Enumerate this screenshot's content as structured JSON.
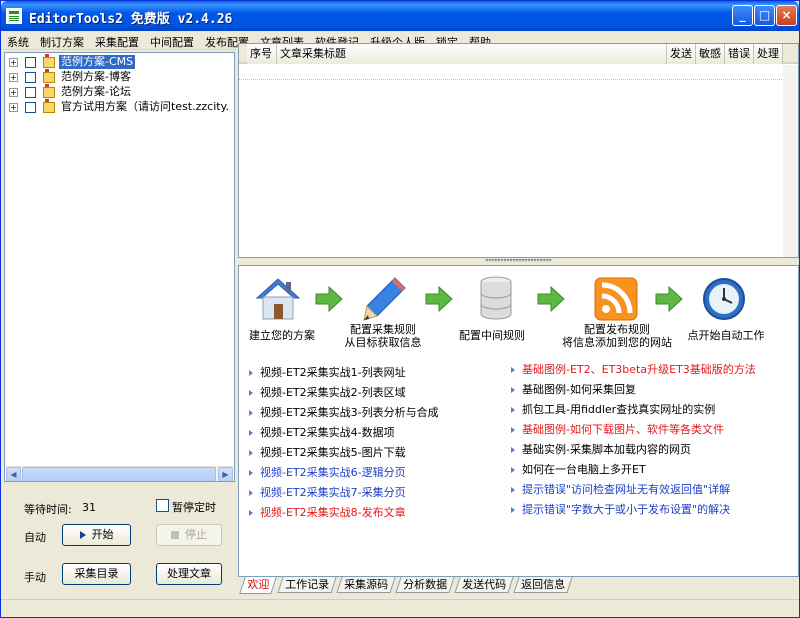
{
  "window": {
    "title": "EditorTools2 免费版 v2.4.26",
    "controls": {
      "minimize": "_",
      "maximize": "□",
      "close": "×"
    }
  },
  "menu": [
    "系统",
    "制订方案",
    "采集配置",
    "中间配置",
    "发布配置",
    "文章列表",
    "软件登记",
    "升级个人版",
    "锁定",
    "帮助"
  ],
  "tree": [
    {
      "label": "范例方案-CMS",
      "selected": true
    },
    {
      "label": "范例方案-博客",
      "selected": false
    },
    {
      "label": "范例方案-论坛",
      "selected": false
    },
    {
      "label": "官方试用方案（请访问test.zzcity.",
      "selected": false
    }
  ],
  "controls": {
    "wait_label": "等待时间:",
    "wait_value": "31",
    "pause_label": "暂停定时",
    "auto_label": "自动",
    "start_button": "开始",
    "stop_button": "停止",
    "manual_label": "手动",
    "collect_list_button": "采集目录",
    "process_article_button": "处理文章"
  },
  "list_columns": [
    "序号",
    "文章采集标题",
    "发送",
    "敏感",
    "错误",
    "处理"
  ],
  "steps": [
    {
      "label_line1": "建立您的方案",
      "label_line2": "",
      "icon": "house-icon"
    },
    {
      "label_line1": "配置采集规则",
      "label_line2": "从目标获取信息",
      "icon": "pencil-icon"
    },
    {
      "label_line1": "配置中间规则",
      "label_line2": "",
      "icon": "database-icon"
    },
    {
      "label_line1": "配置发布规则",
      "label_line2": "将信息添加到您的网站",
      "icon": "rss-icon"
    },
    {
      "label_line1": "点开始自动工作",
      "label_line2": "",
      "icon": "clock-icon"
    }
  ],
  "links_left": [
    {
      "text": "视频-ET2采集实战1-列表网址",
      "color": "#000000"
    },
    {
      "text": "视频-ET2采集实战2-列表区域",
      "color": "#000000"
    },
    {
      "text": "视频-ET2采集实战3-列表分析与合成",
      "color": "#000000"
    },
    {
      "text": "视频-ET2采集实战4-数据项",
      "color": "#000000"
    },
    {
      "text": "视频-ET2采集实战5-图片下载",
      "color": "#000000"
    },
    {
      "text": "视频-ET2采集实战6-逻辑分页",
      "color": "#1c3fc8"
    },
    {
      "text": "视频-ET2采集实战7-采集分页",
      "color": "#1c3fc8"
    },
    {
      "text": "视频-ET2采集实战8-发布文章",
      "color": "#e0191b"
    }
  ],
  "links_right": [
    {
      "text": "基础图例-ET2、ET3beta升级ET3基础版的方法",
      "color": "#e0191b"
    },
    {
      "text": "基础图例-如何采集回复",
      "color": "#000000"
    },
    {
      "text": "抓包工具-用fiddler查找真实网址的实例",
      "color": "#000000"
    },
    {
      "text": "基础图例-如何下载图片、软件等各类文件",
      "color": "#e0191b"
    },
    {
      "text": "基础实例-采集脚本加载内容的网页",
      "color": "#000000"
    },
    {
      "text": "如何在一台电脑上多开ET",
      "color": "#000000"
    },
    {
      "text": "提示错误\"访问检查网址无有效返回值\"详解",
      "color": "#1c3fc8"
    },
    {
      "text": "提示错误\"字数大于或小于发布设置\"的解决",
      "color": "#1c3fc8"
    }
  ],
  "tabs": [
    "欢迎",
    "工作记录",
    "采集源码",
    "分析数据",
    "发送代码",
    "返回信息"
  ],
  "active_tab": "欢迎",
  "colors": {
    "accent_red": "#e0191b",
    "link_blue": "#1c3fc8",
    "titlebar": "#0054e3",
    "selection": "#316ac5"
  }
}
